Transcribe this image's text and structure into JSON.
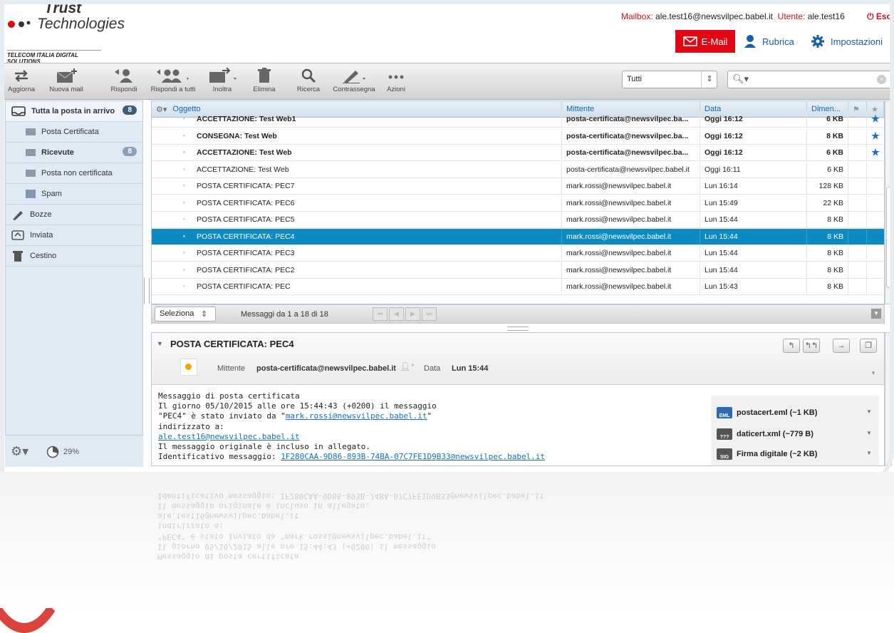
{
  "brand": {
    "line1": "Trust",
    "line2": "Technologies",
    "sub": "TELECOM ITALIA DIGITAL SOLUTIONS"
  },
  "account": {
    "mailbox_label": "Mailbox:",
    "mailbox": "ale.test16@newsvilpec.babel.it",
    "user_label": "Utente:",
    "user": "ale.test16",
    "logout": "Esc"
  },
  "nav": {
    "email": "E-Mail",
    "rubrica": "Rubrica",
    "impostazioni": "Impostazioni"
  },
  "toolbar": {
    "aggiorna": "Aggiorna",
    "nuova": "Nuova mail",
    "rispondi": "Rispondi",
    "rispondi_tutti": "Rispondi a tutti",
    "inoltra": "Inoltra",
    "elimina": "Elimina",
    "ricerca": "Ricerca",
    "contrassegna": "Contrassegna",
    "azioni": "Azioni",
    "filter_value": "Tutti",
    "search_placeholder": ""
  },
  "sidebar": {
    "inbox": {
      "label": "Tutta la posta in arrivo",
      "count": "8"
    },
    "certificata": "Posta Certificata",
    "ricevute": {
      "label": "Ricevute",
      "count": "8"
    },
    "non_certificata": "Posta non certificata",
    "spam": "Spam",
    "bozze": "Bozze",
    "inviata": "Inviata",
    "cestino": "Cestino",
    "quota": "29%",
    "quota_value": 0.29
  },
  "list": {
    "columns": {
      "oggetto": "Oggetto",
      "mittente": "Mittente",
      "data": "Data",
      "dimensione": "Dimen..."
    },
    "rows": [
      {
        "subject": "ACCETTAZIONE: Test Web1",
        "from": "posta-certificata@newsvilpec.ba...",
        "date": "Oggi 16:12",
        "size": "6 KB",
        "unread": true,
        "starred": true
      },
      {
        "subject": "CONSEGNA: Test Web",
        "from": "posta-certificata@newsvilpec.ba...",
        "date": "Oggi 16:12",
        "size": "8 KB",
        "unread": true,
        "starred": true
      },
      {
        "subject": "ACCETTAZIONE: Test Web",
        "from": "posta-certificata@newsvilpec.ba...",
        "date": "Oggi 16:12",
        "size": "6 KB",
        "unread": true,
        "starred": true
      },
      {
        "subject": "ACCETTAZIONE: Test Web",
        "from": "posta-certificata@newsvilpec.babel.it",
        "date": "Oggi 16:11",
        "size": "6 KB",
        "unread": false,
        "starred": false
      },
      {
        "subject": "POSTA CERTIFICATA: PEC7",
        "from": "mark.rossi@newsvilpec.babel.it",
        "date": "Lun 16:14",
        "size": "128 KB",
        "unread": false,
        "starred": false
      },
      {
        "subject": "POSTA CERTIFICATA: PEC6",
        "from": "mark.rossi@newsvilpec.babel.it",
        "date": "Lun 15:49",
        "size": "22 KB",
        "unread": false,
        "starred": false
      },
      {
        "subject": "POSTA CERTIFICATA: PEC5",
        "from": "mark.rossi@newsvilpec.babel.it",
        "date": "Lun 15:44",
        "size": "8 KB",
        "unread": false,
        "starred": false
      },
      {
        "subject": "POSTA CERTIFICATA: PEC4",
        "from": "mark.rossi@newsvilpec.babel.it",
        "date": "Lun 15:44",
        "size": "8 KB",
        "unread": false,
        "starred": false,
        "selected": true
      },
      {
        "subject": "POSTA CERTIFICATA: PEC3",
        "from": "mark.rossi@newsvilpec.babel.it",
        "date": "Lun 15:44",
        "size": "8 KB",
        "unread": false,
        "starred": false
      },
      {
        "subject": "POSTA CERTIFICATA: PEC2",
        "from": "mark.rossi@newsvilpec.babel.it",
        "date": "Lun 15:44",
        "size": "8 KB",
        "unread": false,
        "starred": false
      },
      {
        "subject": "POSTA CERTIFICATA: PEC",
        "from": "mark.rossi@newsvilpec.babel.it",
        "date": "Lun 15:43",
        "size": "8 KB",
        "unread": false,
        "starred": false
      }
    ],
    "select_label": "Seleziona",
    "paging": "Messaggi da 1 a 18 di 18"
  },
  "preview": {
    "subject": "POSTA CERTIFICATA: PEC4",
    "from_label": "Mittente",
    "from": "posta-certificata@newsvilpec.babel.it",
    "date_label": "Data",
    "date": "Lun 15:44",
    "body_lines": [
      "Messaggio di posta certificata",
      "Il giorno 05/10/2015 alle ore 15:44:43 (+0200) il messaggio",
      "\"PEC4\" è stato inviato da \"",
      "indirizzato a:",
      "",
      "Il messaggio originale è incluso in allegato.",
      "Identificativo messaggio: "
    ],
    "link_sender": "mark.rossi@newsvilpec.babel.it",
    "link_recipient": "ale.test16@newsvilpec.babel.it",
    "message_id": "1F280CAA-9D86-893B-74BA-07C7FE1D9B33@newsvilpec.babel.it",
    "attachments": [
      {
        "name": "postacert.eml (~1 KB)",
        "badge": "EML"
      },
      {
        "name": "daticert.xml (~779 B)",
        "badge": "???"
      },
      {
        "name": "Firma digitale (~2 KB)",
        "badge": "SIG"
      }
    ]
  },
  "colors": {
    "accent_red": "#e30613",
    "selection_blue": "#0e8ac2",
    "link_blue": "#1a5fa8",
    "sidebar_bg": "#dfeaf4"
  }
}
